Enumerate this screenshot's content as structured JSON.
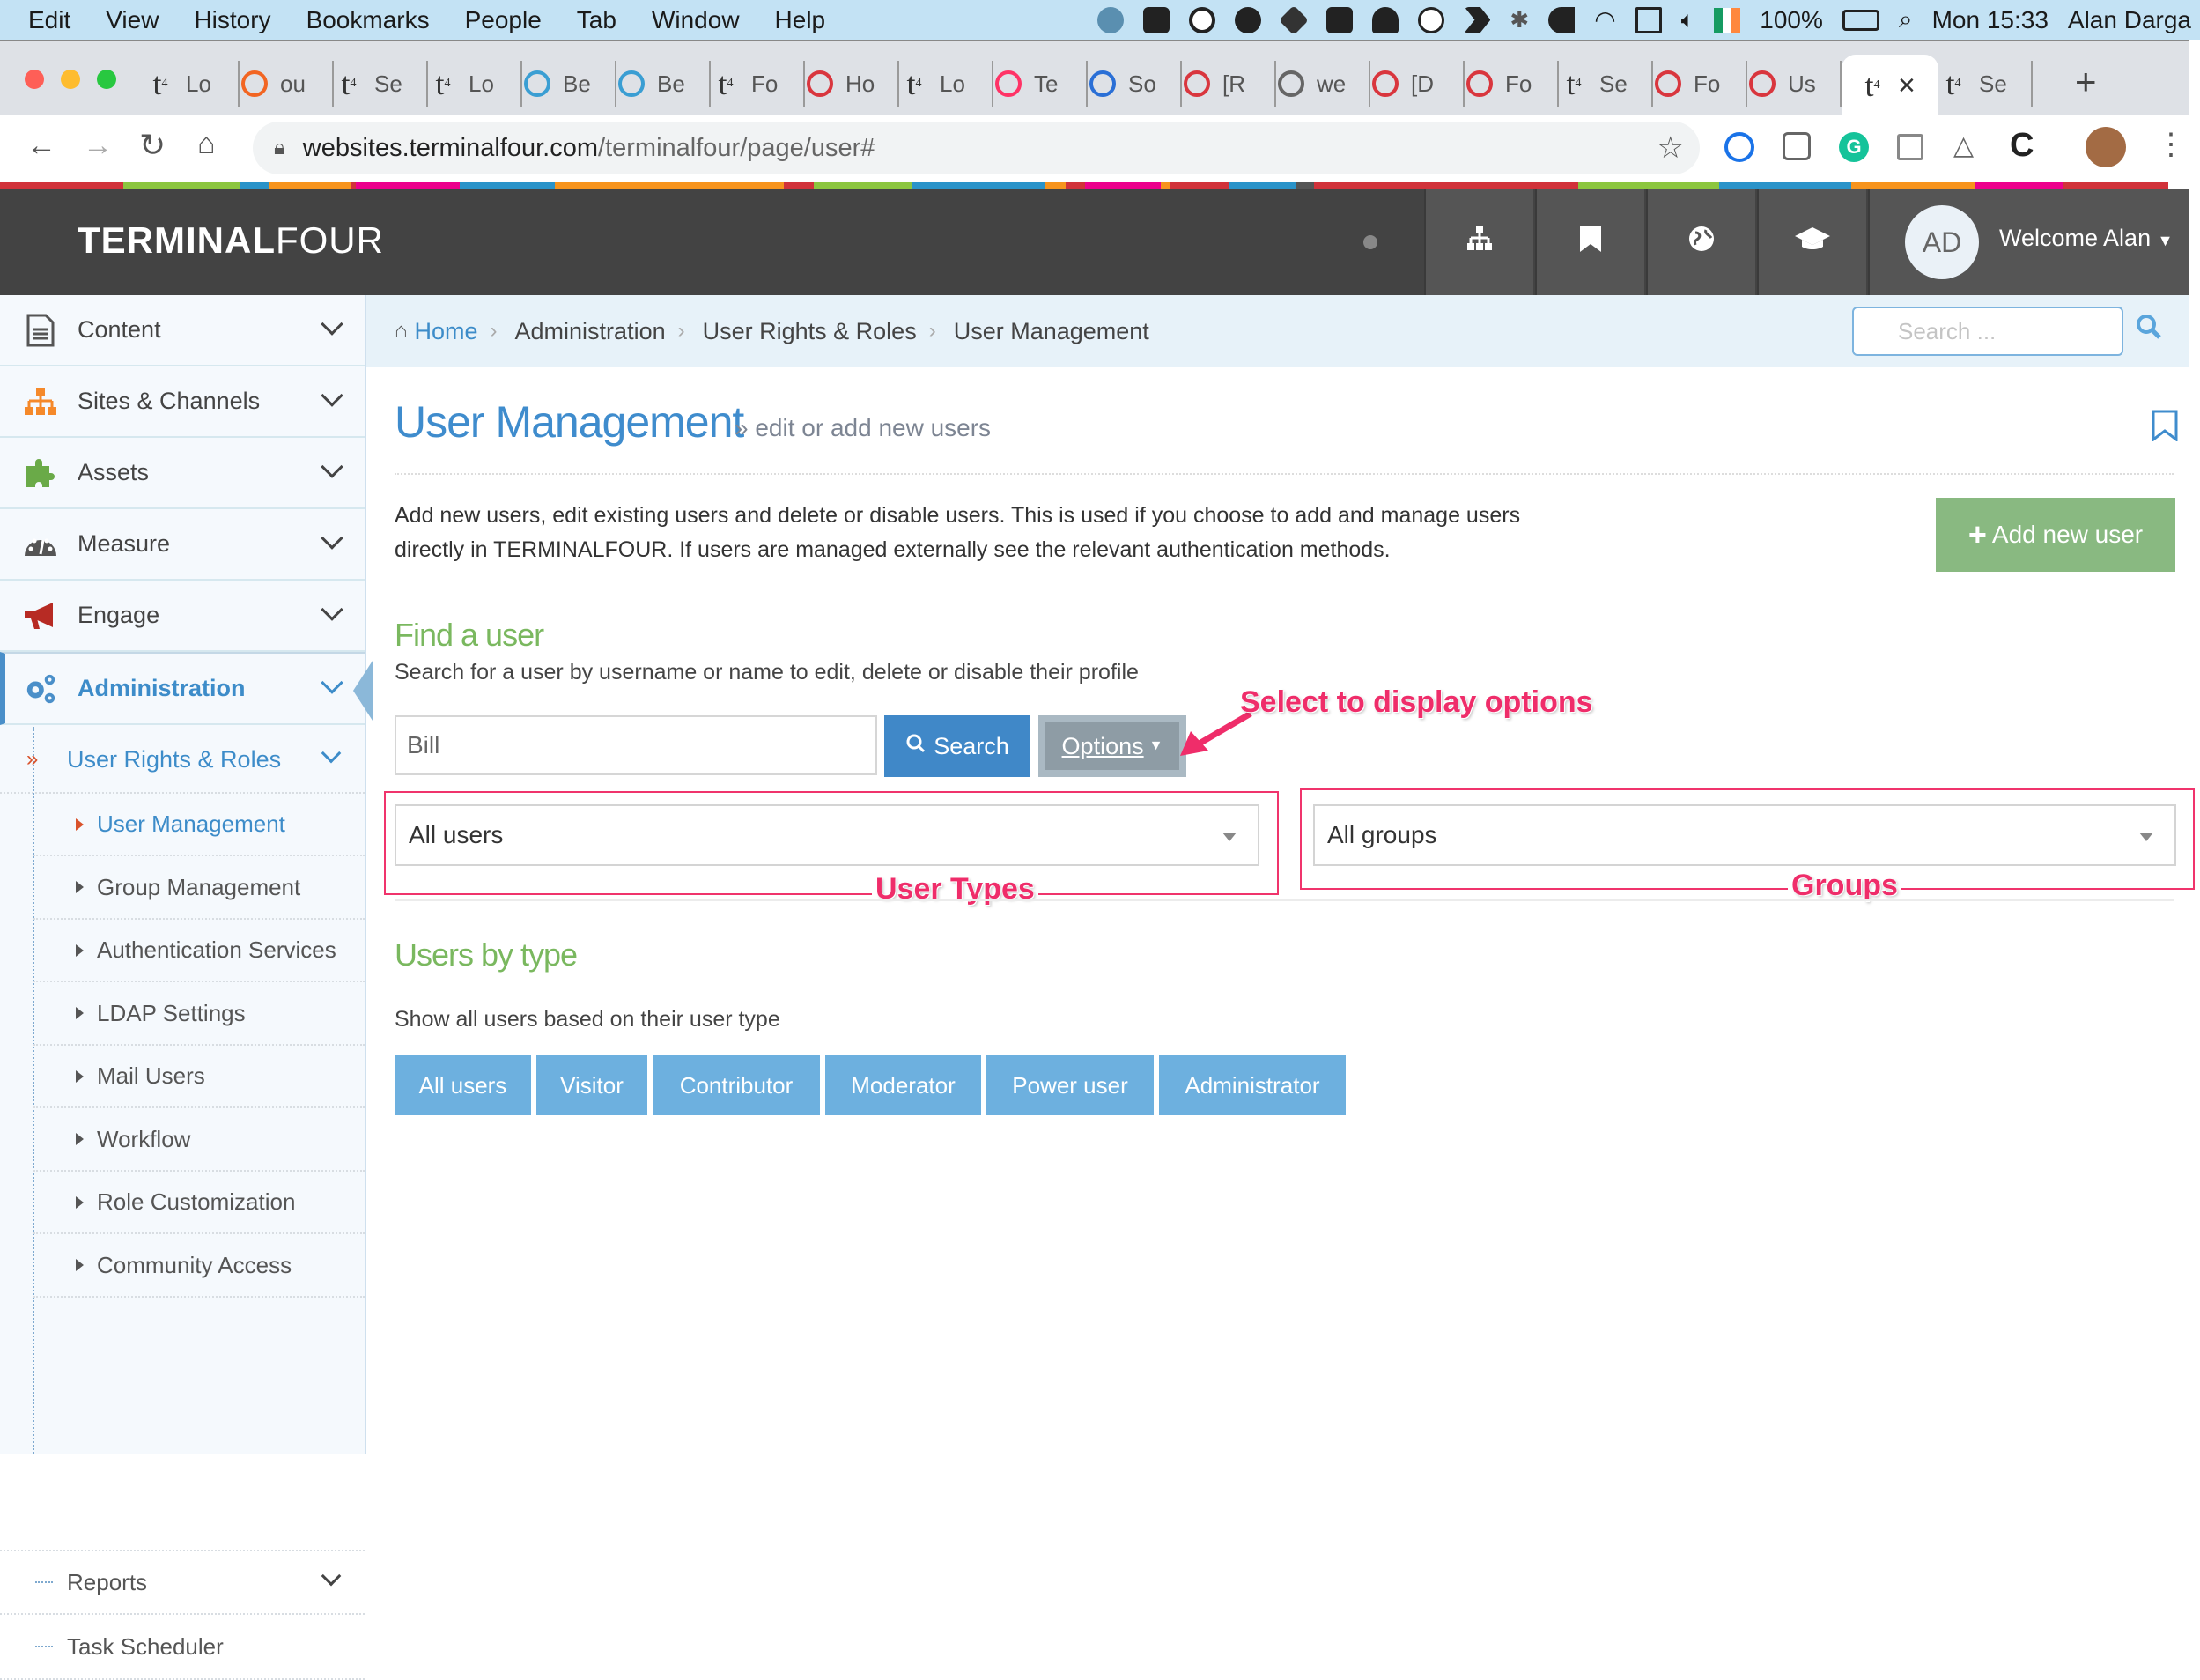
{
  "menubar": {
    "items": [
      "Edit",
      "View",
      "History",
      "Bookmarks",
      "People",
      "Tab",
      "Window",
      "Help"
    ],
    "battery": "100%",
    "clock": "Mon 15:33",
    "user": "Alan Darga"
  },
  "browser": {
    "tabs": [
      {
        "icon": "t4",
        "label": "Lo"
      },
      {
        "icon": "asterisk",
        "label": "ou"
      },
      {
        "icon": "t4",
        "label": "Se"
      },
      {
        "icon": "t4",
        "label": "Lo"
      },
      {
        "icon": "basecamp",
        "label": "Be"
      },
      {
        "icon": "basecamp",
        "label": "Be"
      },
      {
        "icon": "t4",
        "label": "Fo"
      },
      {
        "icon": "red-circle",
        "label": "Ho"
      },
      {
        "icon": "t4",
        "label": "Lo"
      },
      {
        "icon": "invision",
        "label": "Te"
      },
      {
        "icon": "check",
        "label": "So"
      },
      {
        "icon": "red-circle",
        "label": "[R"
      },
      {
        "icon": "globe",
        "label": "we"
      },
      {
        "icon": "red-circle",
        "label": "[D"
      },
      {
        "icon": "red-circle",
        "label": "Fo"
      },
      {
        "icon": "t4",
        "label": "Se"
      },
      {
        "icon": "red-circle",
        "label": "Fo"
      },
      {
        "icon": "red-circle",
        "label": "Us"
      },
      {
        "icon": "t4",
        "label": "",
        "active": true
      },
      {
        "icon": "t4",
        "label": "Se"
      }
    ],
    "url_host": "websites.terminalfour.com",
    "url_path": "/terminalfour/page/user#"
  },
  "header": {
    "logo_bold": "TERMINAL",
    "logo_light": "FOUR",
    "avatar_initials": "AD",
    "welcome": "Welcome Alan"
  },
  "sidebar": {
    "items": [
      {
        "label": "Content",
        "icon": "document-icon"
      },
      {
        "label": "Sites & Channels",
        "icon": "sitemap-icon"
      },
      {
        "label": "Assets",
        "icon": "puzzle-icon"
      },
      {
        "label": "Measure",
        "icon": "dashboard-icon"
      },
      {
        "label": "Engage",
        "icon": "megaphone-icon"
      },
      {
        "label": "Administration",
        "icon": "gears-icon",
        "active": true
      }
    ],
    "group": "User Rights & Roles",
    "subitems": [
      "User Management",
      "Group Management",
      "Authentication Services",
      "LDAP Settings",
      "Mail Users",
      "Workflow",
      "Role Customization",
      "Community Access"
    ],
    "after": [
      "Reports",
      "Task Scheduler"
    ]
  },
  "breadcrumb": {
    "items": [
      "Home",
      "Administration",
      "User Rights & Roles",
      "User Management"
    ],
    "search_placeholder": "Search ..."
  },
  "page": {
    "title": "User Management",
    "subtitle": "» edit or add new users",
    "description": "Add new users, edit existing users and delete or disable users. This is used if you choose to add and manage users directly in TERMINALFOUR. If users are managed externally see the relevant authentication methods.",
    "add_button": "Add new user",
    "find_heading": "Find a user",
    "find_text": "Search for a user by username or name to edit, delete or disable their profile",
    "search_value": "Bill",
    "search_button": "Search",
    "options_button": "Options",
    "user_type_select": "All users",
    "group_select": "All groups",
    "bytype_heading": "Users by type",
    "bytype_text": "Show all users based on their user type",
    "type_buttons": [
      "All users",
      "Visitor",
      "Contributor",
      "Moderator",
      "Power user",
      "Administrator"
    ]
  },
  "annotations": {
    "options": "Select to display options",
    "user_types": "User Types",
    "groups": "Groups"
  },
  "colors": {
    "accent_blue": "#3f8ccd",
    "green_heading": "#7ab85f",
    "add_button": "#89b981",
    "annotation": "#ef2d6a",
    "header_bg": "#434343"
  }
}
